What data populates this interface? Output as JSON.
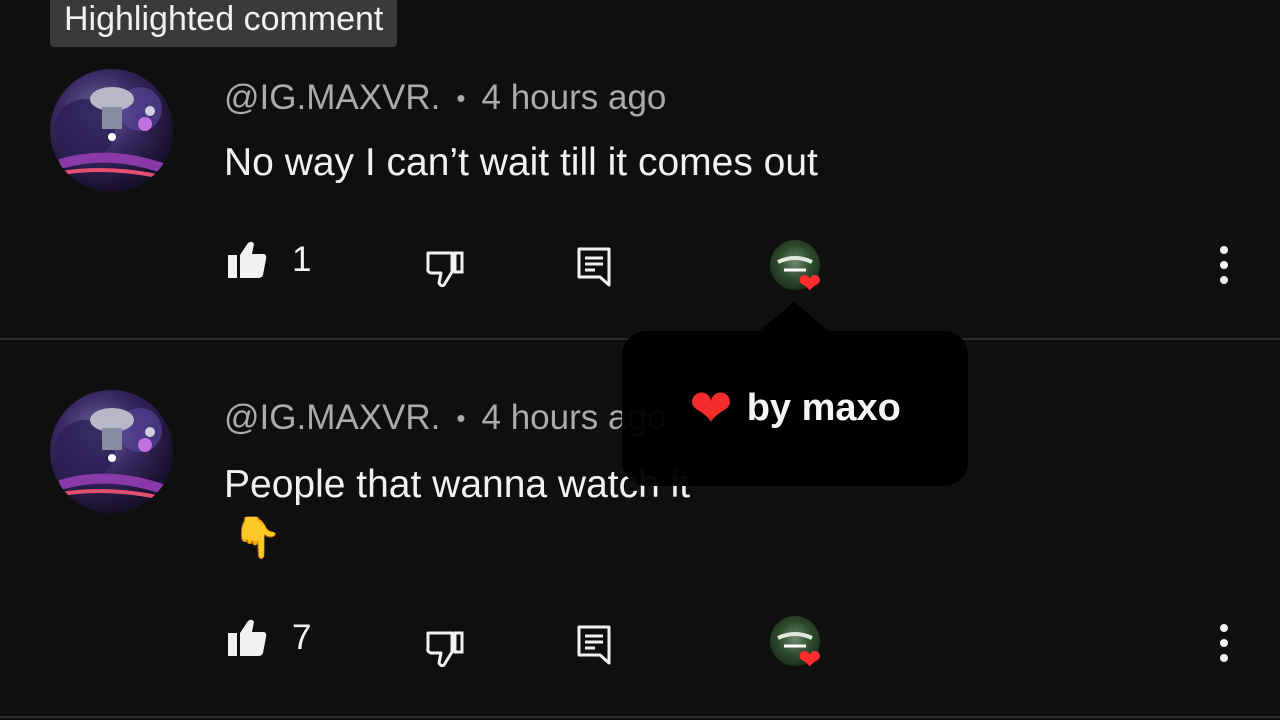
{
  "highlight_badge": "Highlighted comment",
  "comments": [
    {
      "author": "@IG.MAXVR.",
      "separator": "•",
      "time": "4 hours ago",
      "text": "No way I can’t wait till it comes out",
      "emoji": "",
      "likes": "1"
    },
    {
      "author": "@IG.MAXVR.",
      "separator": "•",
      "time": "4 hours ago",
      "text": "People that wanna watch it",
      "emoji": "👇",
      "likes": "7"
    }
  ],
  "tooltip": {
    "heart": "❤",
    "label": "by maxo"
  },
  "icons": {
    "like": "thumbs-up-icon",
    "dislike": "thumbs-down-icon",
    "reply": "reply-icon",
    "creator_heart": "creator-heart-icon",
    "more": "more-vertical-icon"
  },
  "colors": {
    "background": "#0f0f0f",
    "text": "#f1f1f1",
    "secondary": "#aaaaaa",
    "heart": "#ff2d2d"
  }
}
